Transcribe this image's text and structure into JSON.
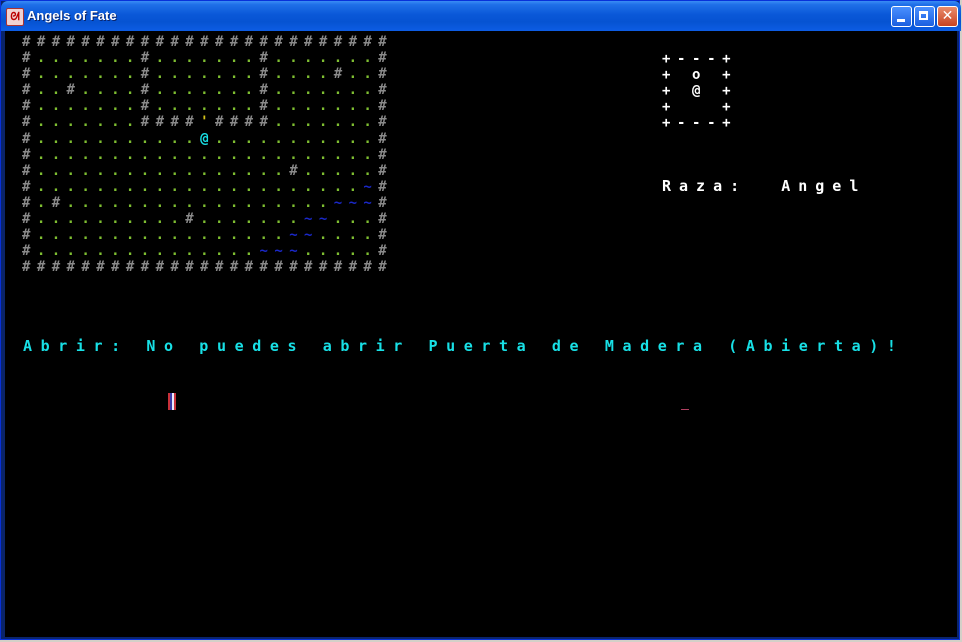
{
  "window": {
    "title": "Angels of Fate",
    "controls": {
      "minimize": "minimize",
      "maximize": "maximize",
      "close": "✕"
    },
    "app_icon": "dragon-icon"
  },
  "map": {
    "rows": [
      "#########################",
      "#.......#.......#.......#",
      "#.......#.......#....#..#",
      "#..#....#.......#.......#",
      "#.......#.......#.......#",
      "#.......####'####.......#",
      "#...........@...........#",
      "#.......................#",
      "#.................#.....#",
      "#......................~#",
      "#.#..................~~~#",
      "#..........#.......~~...#",
      "#.................~~....#",
      "#...............~~~.....#",
      "#########################"
    ],
    "colors": {
      "wall": "#8a8a8a",
      "floor": "#7fbf32",
      "water": "#1a28c8",
      "player": "#18e0e6",
      "door": "#d4c21a"
    }
  },
  "minimap": {
    "rows": [
      "+---+",
      "+ o +",
      "+ @ +",
      "+   +",
      "+---+"
    ]
  },
  "race": {
    "label": "Raza:",
    "value": "Angel"
  },
  "message": {
    "text": "Abrir: No puedes abrir Puerta de Madera (Abierta)!"
  }
}
